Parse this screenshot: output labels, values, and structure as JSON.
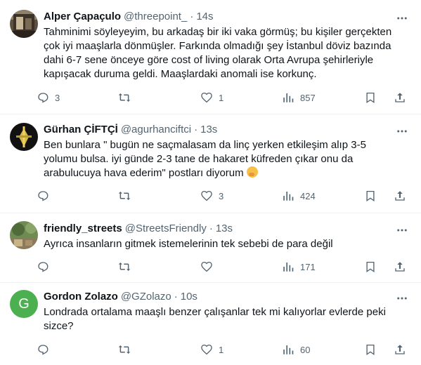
{
  "colors": {
    "muted": "#536471",
    "text": "#0f1419",
    "divider": "#eff3f4",
    "avatar_g": "#4caf50"
  },
  "tweets": [
    {
      "name": "Alper Çapaçulo",
      "handle": "@threepoint_",
      "time": "14s",
      "text": "Tahminimi söyleyeyim, bu arkadaş bir iki vaka görmüş; bu kişiler gerçekten çok iyi maaşlarla dönmüşler. Farkında olmadığı şey İstanbul döviz bazında dahi 6-7 sene önceye göre cost of living olarak Orta Avrupa şehirleriyle kapışacak duruma geldi. Maaşlardaki anomali ise korkunç.",
      "replies": "3",
      "retweets": "",
      "likes": "1",
      "views": "857"
    },
    {
      "name": "Gürhan ÇİFTÇİ",
      "handle": "@agurhanciftci",
      "time": "13s",
      "text": "Ben bunlara \" bugün ne saçmalasam da linç yerken etkileşim alıp 3-5 yolumu bulsa. iyi günde 2-3 tane de hakaret küfreden çıkar onu da arabulucuya hava ederim\" postları diyorum",
      "replies": "",
      "retweets": "",
      "likes": "3",
      "views": "424"
    },
    {
      "name": "friendly_streets",
      "handle": "@StreetsFriendly",
      "time": "13s",
      "text": "Ayrıca insanların gitmek istemelerinin tek sebebi de para değil",
      "replies": "",
      "retweets": "",
      "likes": "",
      "views": "171"
    },
    {
      "name": "Gordon Zolazo",
      "handle": "@GZolazo",
      "time": "10s",
      "avatar_letter": "G",
      "text": "Londrada ortalama maaşlı benzer çalışanlar tek mi kalıyorlar evlerde peki sizce?",
      "replies": "",
      "retweets": "",
      "likes": "1",
      "views": "60"
    }
  ],
  "icons": {
    "more": "more-icon",
    "reply": "reply-icon",
    "retweet": "retweet-icon",
    "like": "like-icon",
    "views": "views-icon",
    "bookmark": "bookmark-icon",
    "share": "share-icon"
  }
}
